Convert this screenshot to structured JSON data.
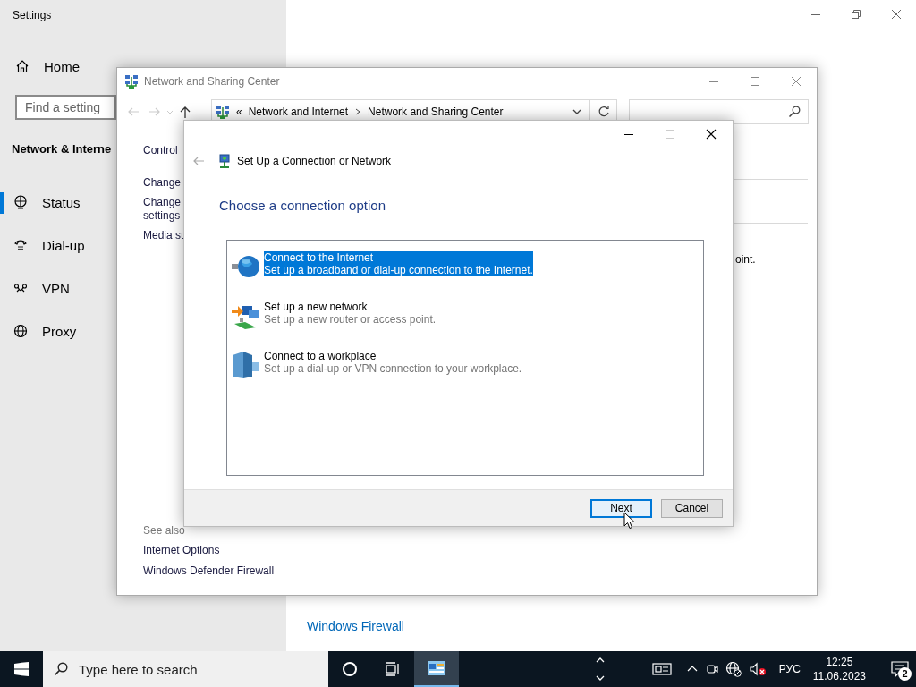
{
  "settings": {
    "title": "Settings",
    "home": "Home",
    "search": {
      "placeholder": "Find a setting"
    },
    "section": "Network & Interne",
    "nav": [
      {
        "kind": "status",
        "label": "Status",
        "selected": true
      },
      {
        "kind": "dialup",
        "label": "Dial-up",
        "selected": false
      },
      {
        "kind": "vpn",
        "label": "VPN",
        "selected": false
      },
      {
        "kind": "proxy",
        "label": "Proxy",
        "selected": false
      }
    ],
    "link": "Windows Firewall"
  },
  "network_window": {
    "title": "Network and Sharing Center",
    "breadcrumb_overflow": "«",
    "breadcrumb": [
      "Network and Internet",
      "Network and Sharing Center"
    ],
    "side_links": [
      {
        "lines": [
          "Control"
        ]
      },
      {
        "lines": [
          "Change"
        ]
      },
      {
        "lines": [
          "Change",
          "settings"
        ]
      },
      {
        "lines": [
          "Media st"
        ]
      }
    ],
    "fragment": "oint.",
    "see_also": {
      "heading": "See also",
      "links": [
        "Internet Options",
        "Windows Defender Firewall"
      ]
    }
  },
  "dialog": {
    "title": "Set Up a Connection or Network",
    "heading": "Choose a connection option",
    "options": [
      {
        "kind": "internet",
        "title": "Connect to the Internet",
        "description": "Set up a broadband or dial-up connection to the Internet.",
        "selected": true
      },
      {
        "kind": "network",
        "title": "Set up a new network",
        "description": "Set up a new router or access point.",
        "selected": false
      },
      {
        "kind": "workplace",
        "title": "Connect to a workplace",
        "description": "Set up a dial-up or VPN connection to your workplace.",
        "selected": false
      }
    ],
    "buttons": [
      {
        "label": "Next",
        "default": true
      },
      {
        "label": "Cancel",
        "default": false
      }
    ]
  },
  "taskbar": {
    "search": {
      "placeholder": "Type here to search"
    },
    "language": "РУС",
    "time": "12:25",
    "date": "11.06.2023",
    "notification_count": "2"
  }
}
